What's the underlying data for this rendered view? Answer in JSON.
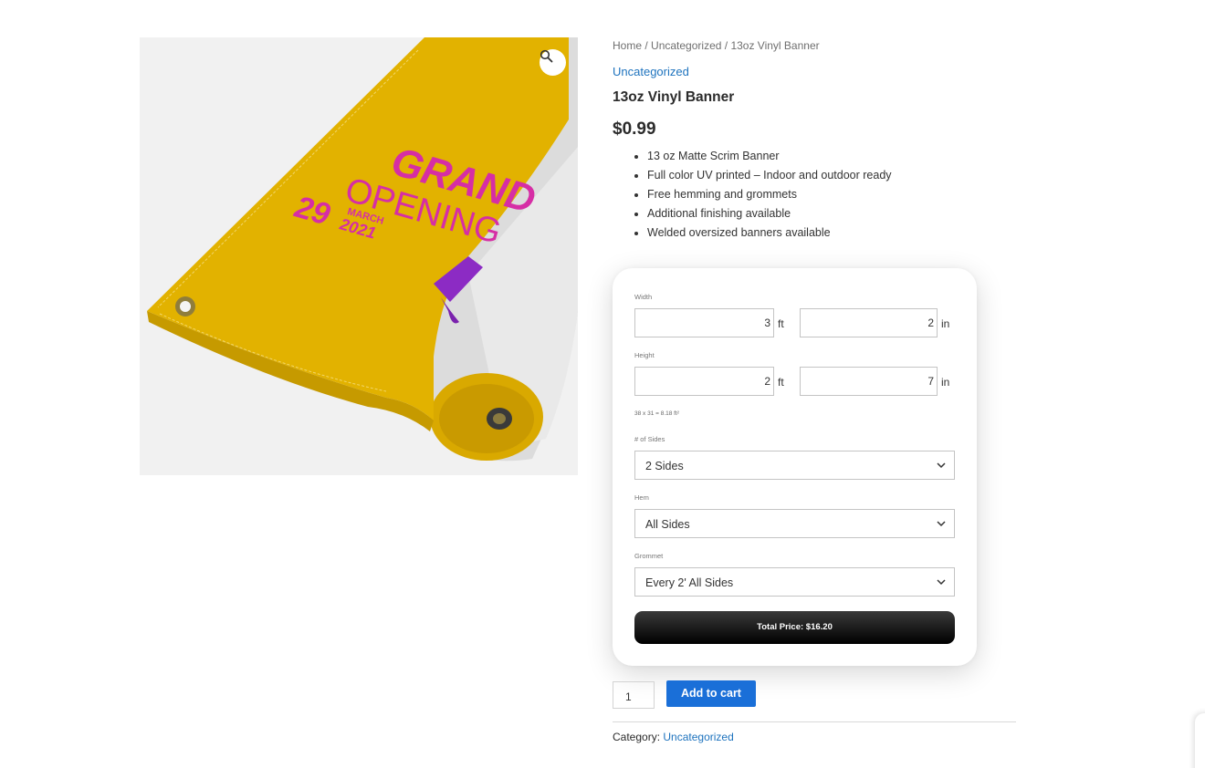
{
  "gallery": {
    "banner_text": {
      "line1": "GRAND",
      "line2": "OPENING",
      "day": "29",
      "month": "MARCH",
      "year": "2021"
    },
    "zoom_icon": "magnifier-icon"
  },
  "breadcrumb": {
    "home": "Home",
    "sep1": " / ",
    "category": "Uncategorized",
    "sep2": " / ",
    "current": "13oz Vinyl Banner"
  },
  "product": {
    "category_link": "Uncategorized",
    "title": "13oz Vinyl Banner",
    "price": "$0.99",
    "features": [
      "13 oz Matte Scrim Banner",
      "Full color UV printed – Indoor and outdoor ready",
      "Free hemming and grommets",
      "Additional finishing available",
      "Welded oversized banners available"
    ]
  },
  "calculator": {
    "width": {
      "label": "Width",
      "ft": "3",
      "ft_unit": "ft",
      "in": "2",
      "in_unit": "in"
    },
    "height": {
      "label": "Height",
      "ft": "2",
      "ft_unit": "ft",
      "in": "7",
      "in_unit": "in"
    },
    "area_note": "38 x 31 = 8.18 ft²",
    "sides": {
      "label": "# of Sides",
      "value": "2 Sides"
    },
    "hem": {
      "label": "Hem",
      "value": "All Sides"
    },
    "grommet": {
      "label": "Grommet",
      "value": "Every 2' All Sides"
    },
    "total_button": "Total Price: $16.20"
  },
  "cart": {
    "quantity": "1",
    "add_to_cart": "Add to cart"
  },
  "meta": {
    "category_label": "Category:",
    "category_value": "Uncategorized"
  },
  "colors": {
    "banner_yellow": "#e2b200",
    "banner_magenta": "#d62ea5",
    "link_blue": "#1e73be",
    "button_blue": "#1a6fd8"
  }
}
